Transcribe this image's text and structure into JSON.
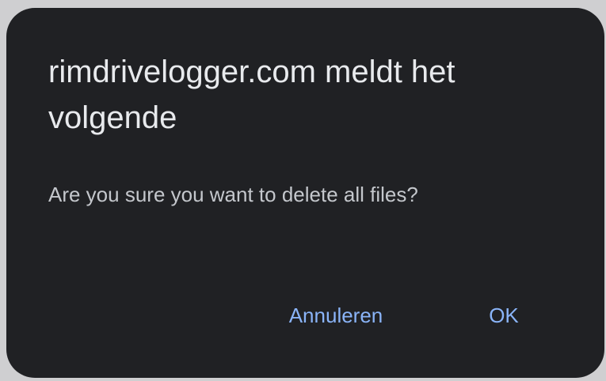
{
  "dialog": {
    "title": "rimdrivelogger.com meldt het volgende",
    "message": "Are you sure you want to delete all files?",
    "cancel_label": "Annuleren",
    "ok_label": "OK"
  },
  "colors": {
    "dialog_background": "#202124",
    "title_text": "#e8eaed",
    "message_text": "#c4c7cc",
    "button_text": "#8ab4f8"
  }
}
